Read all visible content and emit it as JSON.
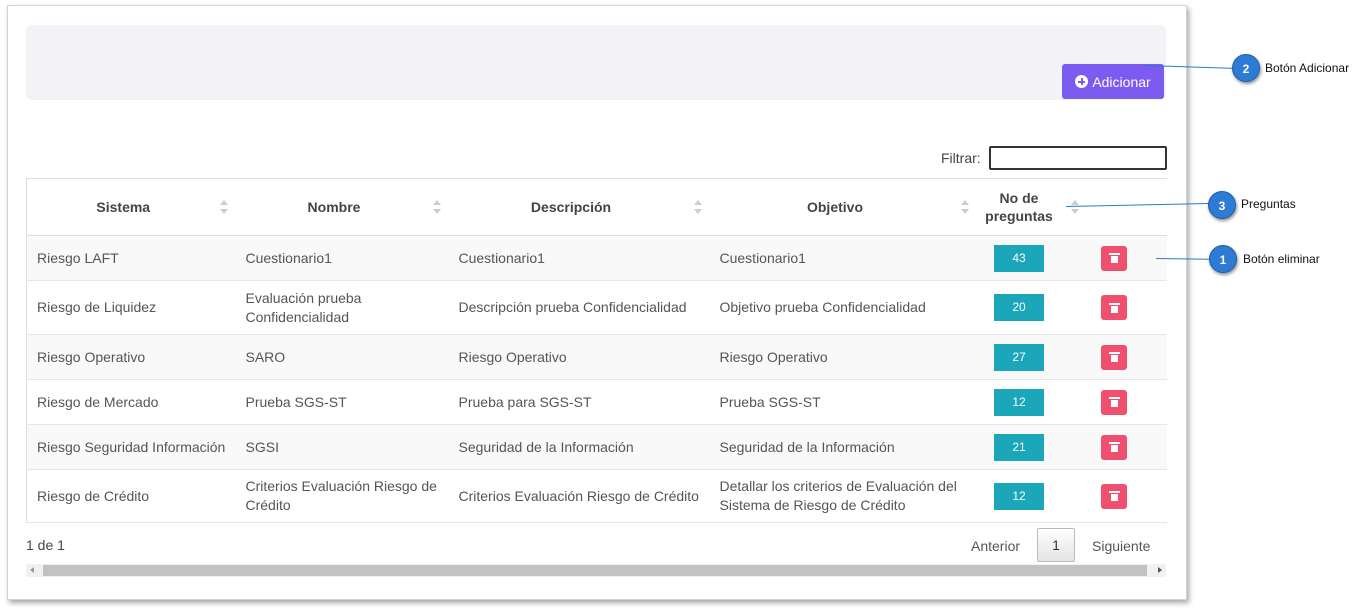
{
  "toolbar": {
    "add_label": "Adicionar"
  },
  "filter": {
    "label": "Filtrar:",
    "value": ""
  },
  "table": {
    "columns": [
      "Sistema",
      "Nombre",
      "Descripción",
      "Objetivo",
      "No de preguntas"
    ],
    "rows": [
      {
        "sistema": "Riesgo LAFT",
        "nombre": "Cuestionario1",
        "descripcion": "Cuestionario1",
        "objetivo": "Cuestionario1",
        "preguntas": "43"
      },
      {
        "sistema": "Riesgo de Liquidez",
        "nombre": "Evaluación prueba Confidencialidad",
        "descripcion": "Descripción prueba Confidencialidad",
        "objetivo": "Objetivo prueba Confidencialidad",
        "preguntas": "20"
      },
      {
        "sistema": "Riesgo Operativo",
        "nombre": "SARO",
        "descripcion": "Riesgo Operativo",
        "objetivo": "Riesgo Operativo",
        "preguntas": "27"
      },
      {
        "sistema": "Riesgo de Mercado",
        "nombre": "Prueba SGS-ST",
        "descripcion": "Prueba para SGS-ST",
        "objetivo": "Prueba SGS-ST",
        "preguntas": "12"
      },
      {
        "sistema": "Riesgo Seguridad Información",
        "nombre": "SGSI",
        "descripcion": "Seguridad de la Información",
        "objetivo": "Seguridad de la Información",
        "preguntas": "21"
      },
      {
        "sistema": "Riesgo de Crédito",
        "nombre": "Criterios Evaluación Riesgo de Crédito",
        "descripcion": "Criterios Evaluación Riesgo de Crédito",
        "objetivo": "Detallar los criterios de Evaluación del Sistema de Riesgo de Crédito",
        "preguntas": "12"
      }
    ]
  },
  "pagination": {
    "info": "1 de 1",
    "prev": "Anterior",
    "page": "1",
    "next": "Siguiente"
  },
  "callouts": [
    {
      "number": "2",
      "text": "Botón Adicionar"
    },
    {
      "number": "3",
      "text": "Preguntas"
    },
    {
      "number": "1",
      "text": "Botón eliminar"
    }
  ],
  "colors": {
    "accent": "#7c5cf0",
    "badge": "#1ba6b9",
    "danger": "#f0506e",
    "callout": "#2d7bd4"
  },
  "icons": {
    "add": "plus-circle-icon",
    "delete": "trash-icon",
    "sort": "sort-icon"
  }
}
